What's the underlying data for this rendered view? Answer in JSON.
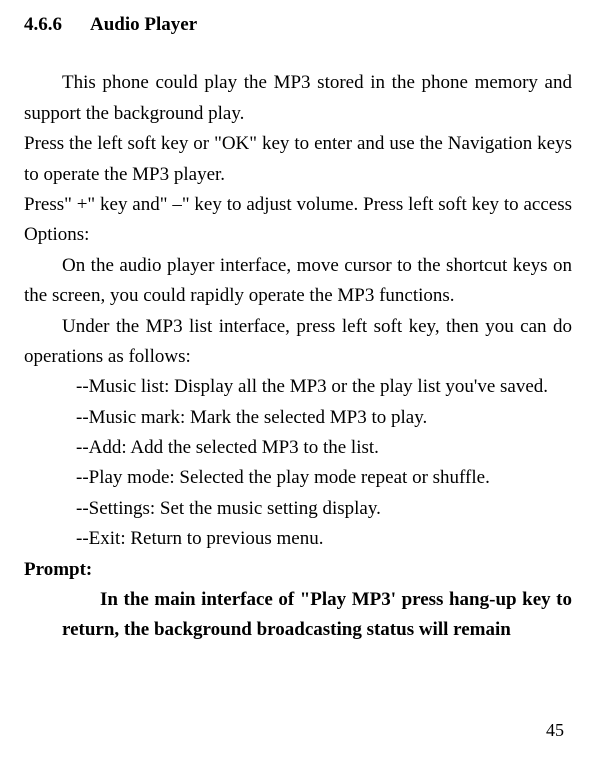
{
  "section": {
    "number": "4.6.6",
    "title": "Audio Player"
  },
  "paragraphs": {
    "p1": "This phone could play the MP3 stored in the phone memory and support the background play.",
    "p2": "Press the left soft key or \"OK\" key to enter and use the Navigation keys to operate the MP3 player.",
    "p3": "Press\" +\" key and\" –\" key to adjust volume. Press left soft key to access Options:",
    "p4": "On the audio player interface, move cursor to the shortcut keys on the screen, you could rapidly operate the MP3 functions.",
    "p5": "Under the MP3 list interface, press left soft key, then you can do operations as follows:"
  },
  "list": {
    "item1": "--Music list: Display all the MP3 or the play list you've saved.",
    "item2": "--Music mark: Mark the selected MP3 to play.",
    "item3": "--Add: Add the selected MP3 to the list.",
    "item4": "--Play mode: Selected the play mode repeat or shuffle.",
    "item5": "--Settings: Set the music setting display.",
    "item6": "--Exit: Return to previous menu."
  },
  "prompt": {
    "label": "Prompt:",
    "text": "In the main interface of \"Play MP3' press hang-up key to return, the background broadcasting status will remain"
  },
  "pageNumber": "45"
}
